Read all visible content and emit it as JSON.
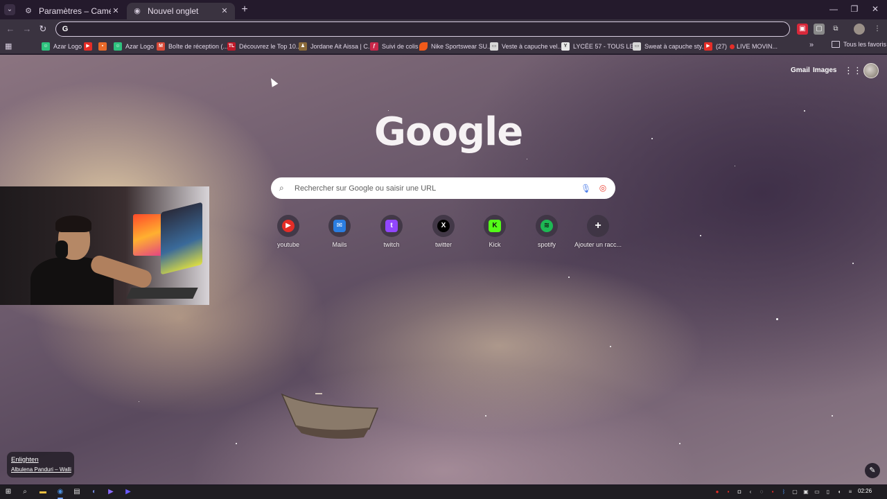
{
  "browser": {
    "tabs": [
      {
        "title": "Paramètres – Caméra",
        "icon": "gear-icon",
        "active": false
      },
      {
        "title": "Nouvel onglet",
        "icon": "chrome-icon",
        "active": true
      }
    ],
    "omnibox": {
      "value": "",
      "placeholder": ""
    },
    "bookmarks": [
      {
        "label": "Azar Logo",
        "icon": "azar-icon",
        "color": "#2ec27e"
      },
      {
        "label": "",
        "icon": "youtube-icon",
        "color": "#e52d27"
      },
      {
        "label": "",
        "icon": "orange-square-icon",
        "color": "#e86a2a"
      },
      {
        "label": "Azar Logo",
        "icon": "azar-icon",
        "color": "#2ec27e"
      },
      {
        "label": "Boîte de réception (...",
        "icon": "gmail-icon",
        "color": "#d84a38"
      },
      {
        "label": "Découvrez le Top 10...",
        "icon": "tl-icon",
        "color": "#c01a2a"
      },
      {
        "label": "Jordane Ait Aissa | C...",
        "icon": "person-icon",
        "color": "#8a6a3a"
      },
      {
        "label": "Suivi de colis",
        "icon": "parcel-icon",
        "color": "#c8284a"
      },
      {
        "label": "Nike Sportswear SU...",
        "icon": "nike-icon",
        "color": "#f05a1a"
      },
      {
        "label": "Veste à capuche vel...",
        "icon": "page-icon",
        "color": "#d8d8d8"
      },
      {
        "label": "LYCÉE 57 - TOUS LE...",
        "icon": "y-icon",
        "color": "#e8e8e8"
      },
      {
        "label": "Sweat à capuche sty...",
        "icon": "page-icon",
        "color": "#d8d8d8"
      },
      {
        "label": "(27)",
        "icon": "youtube-icon",
        "color": "#e52d27"
      }
    ],
    "bookmark_live": "LIVE MOVIN...",
    "all_bookmarks": "Tous les favoris"
  },
  "ntp": {
    "links": {
      "gmail": "Gmail",
      "images": "Images"
    },
    "logo": "Google",
    "search_placeholder": "Rechercher sur Google ou saisir une URL",
    "shortcuts": [
      {
        "label": "youtube",
        "icon": "youtube-icon",
        "color": "#e52d27",
        "glyph": "▶"
      },
      {
        "label": "Mails",
        "icon": "outlook-icon",
        "color": "#2a7de0",
        "glyph": "✉"
      },
      {
        "label": "twitch",
        "icon": "twitch-icon",
        "color": "#9146ff",
        "glyph": "t"
      },
      {
        "label": "twitter",
        "icon": "x-icon",
        "color": "#000000",
        "glyph": "X"
      },
      {
        "label": "Kick",
        "icon": "kick-icon",
        "color": "#53fc18",
        "glyph": "K"
      },
      {
        "label": "spotify",
        "icon": "spotify-icon",
        "color": "#1db954",
        "glyph": "≋"
      },
      {
        "label": "Ajouter un racc...",
        "icon": "plus-icon",
        "color": "#3c3442",
        "glyph": "+"
      }
    ],
    "attribution": {
      "title": "Enlighten",
      "author": "Albulena Panduri – Walli"
    }
  },
  "taskbar": {
    "clock": "02:26"
  }
}
